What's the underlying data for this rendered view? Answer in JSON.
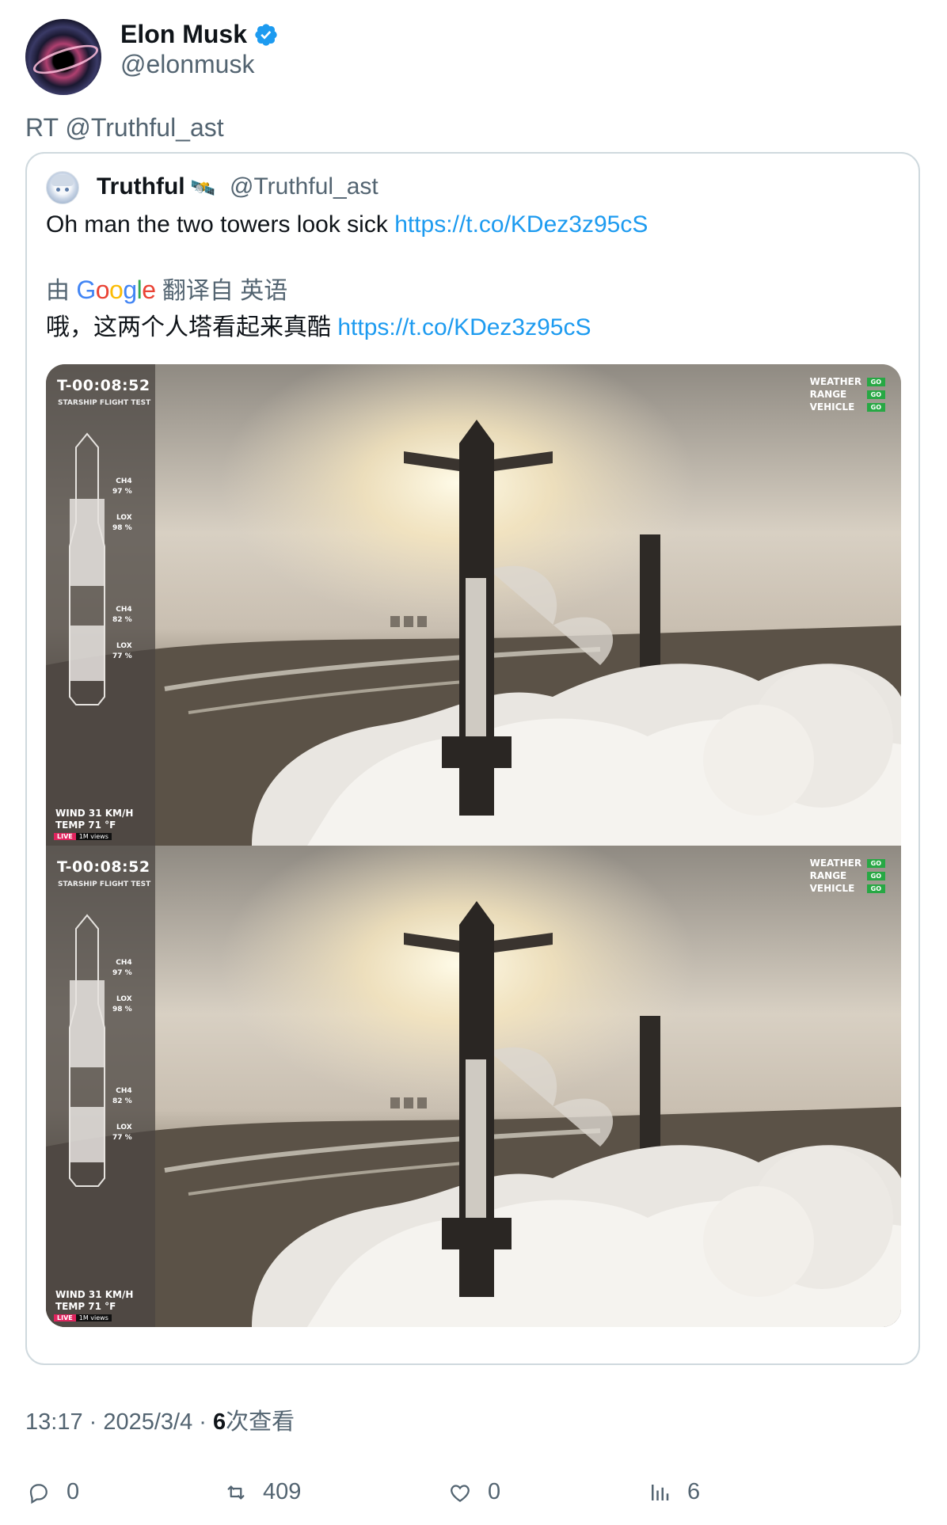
{
  "author": {
    "name": "Elon Musk",
    "handle": "@elonmusk",
    "verified": true
  },
  "retweet_line": "RT @Truthful_ast",
  "quoted": {
    "name": "Truthful",
    "name_emoji": "🛰️",
    "handle": "@Truthful_ast",
    "text": "Oh man the two towers look sick",
    "link": "https://t.co/KDez3z95cS",
    "translation": {
      "prefix": "由",
      "provider": "Google",
      "suffix": "翻译自 英语",
      "text": "哦，这两个人塔看起来真酷",
      "link": "https://t.co/KDez3z95cS"
    }
  },
  "media_overlay": {
    "countdown": "T-00:08:52",
    "subtitle": "STARSHIP FLIGHT TEST",
    "status": [
      "WEATHER",
      "RANGE",
      "VEHICLE"
    ],
    "status_value": "GO",
    "ship_ch4": "CH4\n97 %",
    "ship_lox": "LOX\n98 %",
    "booster_ch4": "CH4\n82 %",
    "booster_lox": "LOX\n77 %",
    "wind": "WIND  31 KM/H",
    "temp": "TEMP  71 °F",
    "live": "LIVE",
    "views": "1M views"
  },
  "meta": {
    "time": "13:17",
    "date": "2025/3/4",
    "views_count": "6",
    "views_label": "次查看"
  },
  "actions": {
    "replies": "0",
    "retweets": "409",
    "likes": "0",
    "views": "6"
  },
  "colors": {
    "link": "#1d9bf0",
    "secondary_text": "#536471",
    "border": "#cfd9de",
    "verified": "#1d9bf0"
  }
}
